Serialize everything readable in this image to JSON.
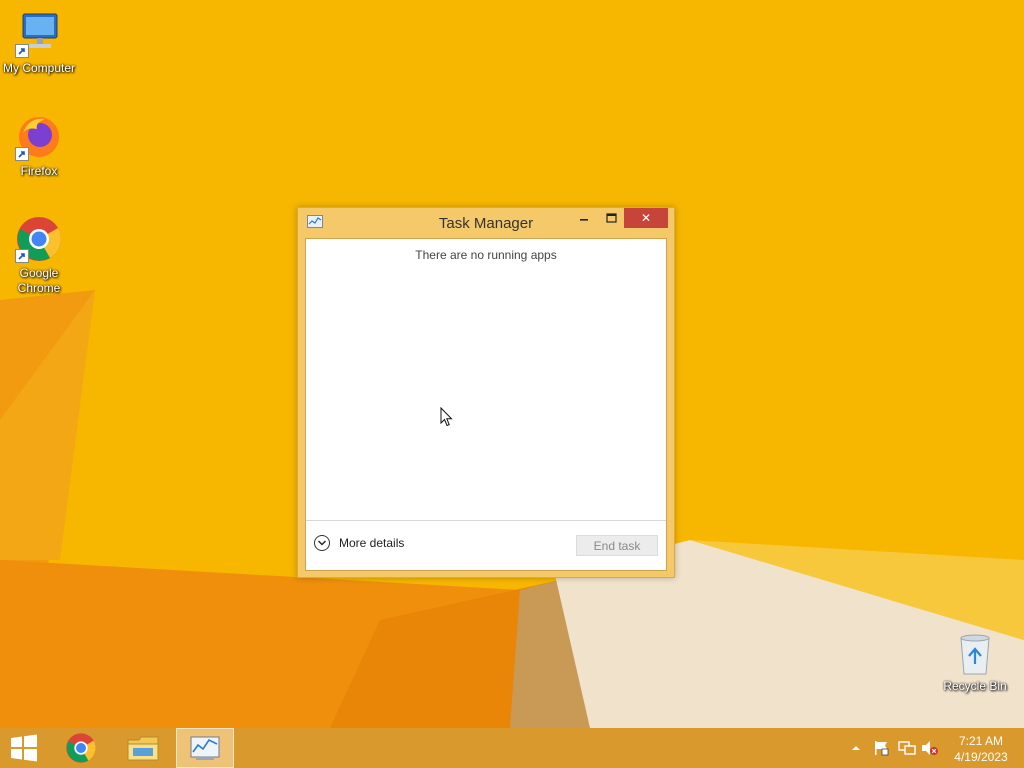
{
  "desktop": {
    "icons": [
      {
        "label": "My Computer",
        "icon": "computer-icon"
      },
      {
        "label": "Firefox",
        "icon": "firefox-icon"
      },
      {
        "label": "Google Chrome",
        "icon": "chrome-icon"
      },
      {
        "label": "Recycle Bin",
        "icon": "recycle-bin-icon"
      }
    ]
  },
  "window": {
    "title": "Task Manager",
    "empty_message": "There are no running apps",
    "more_details_label": "More details",
    "end_task_label": "End task",
    "close_glyph": "✕"
  },
  "taskbar": {
    "items": [
      "start-button",
      "chrome-icon",
      "file-explorer-icon",
      "task-manager-icon"
    ],
    "clock_time": "7:21 AM",
    "clock_date": "4/19/2023"
  },
  "colors": {
    "desktop": "#f7b600",
    "window_frame": "#f5c96a",
    "close_button": "#c7443a",
    "taskbar": "#d9992d"
  }
}
